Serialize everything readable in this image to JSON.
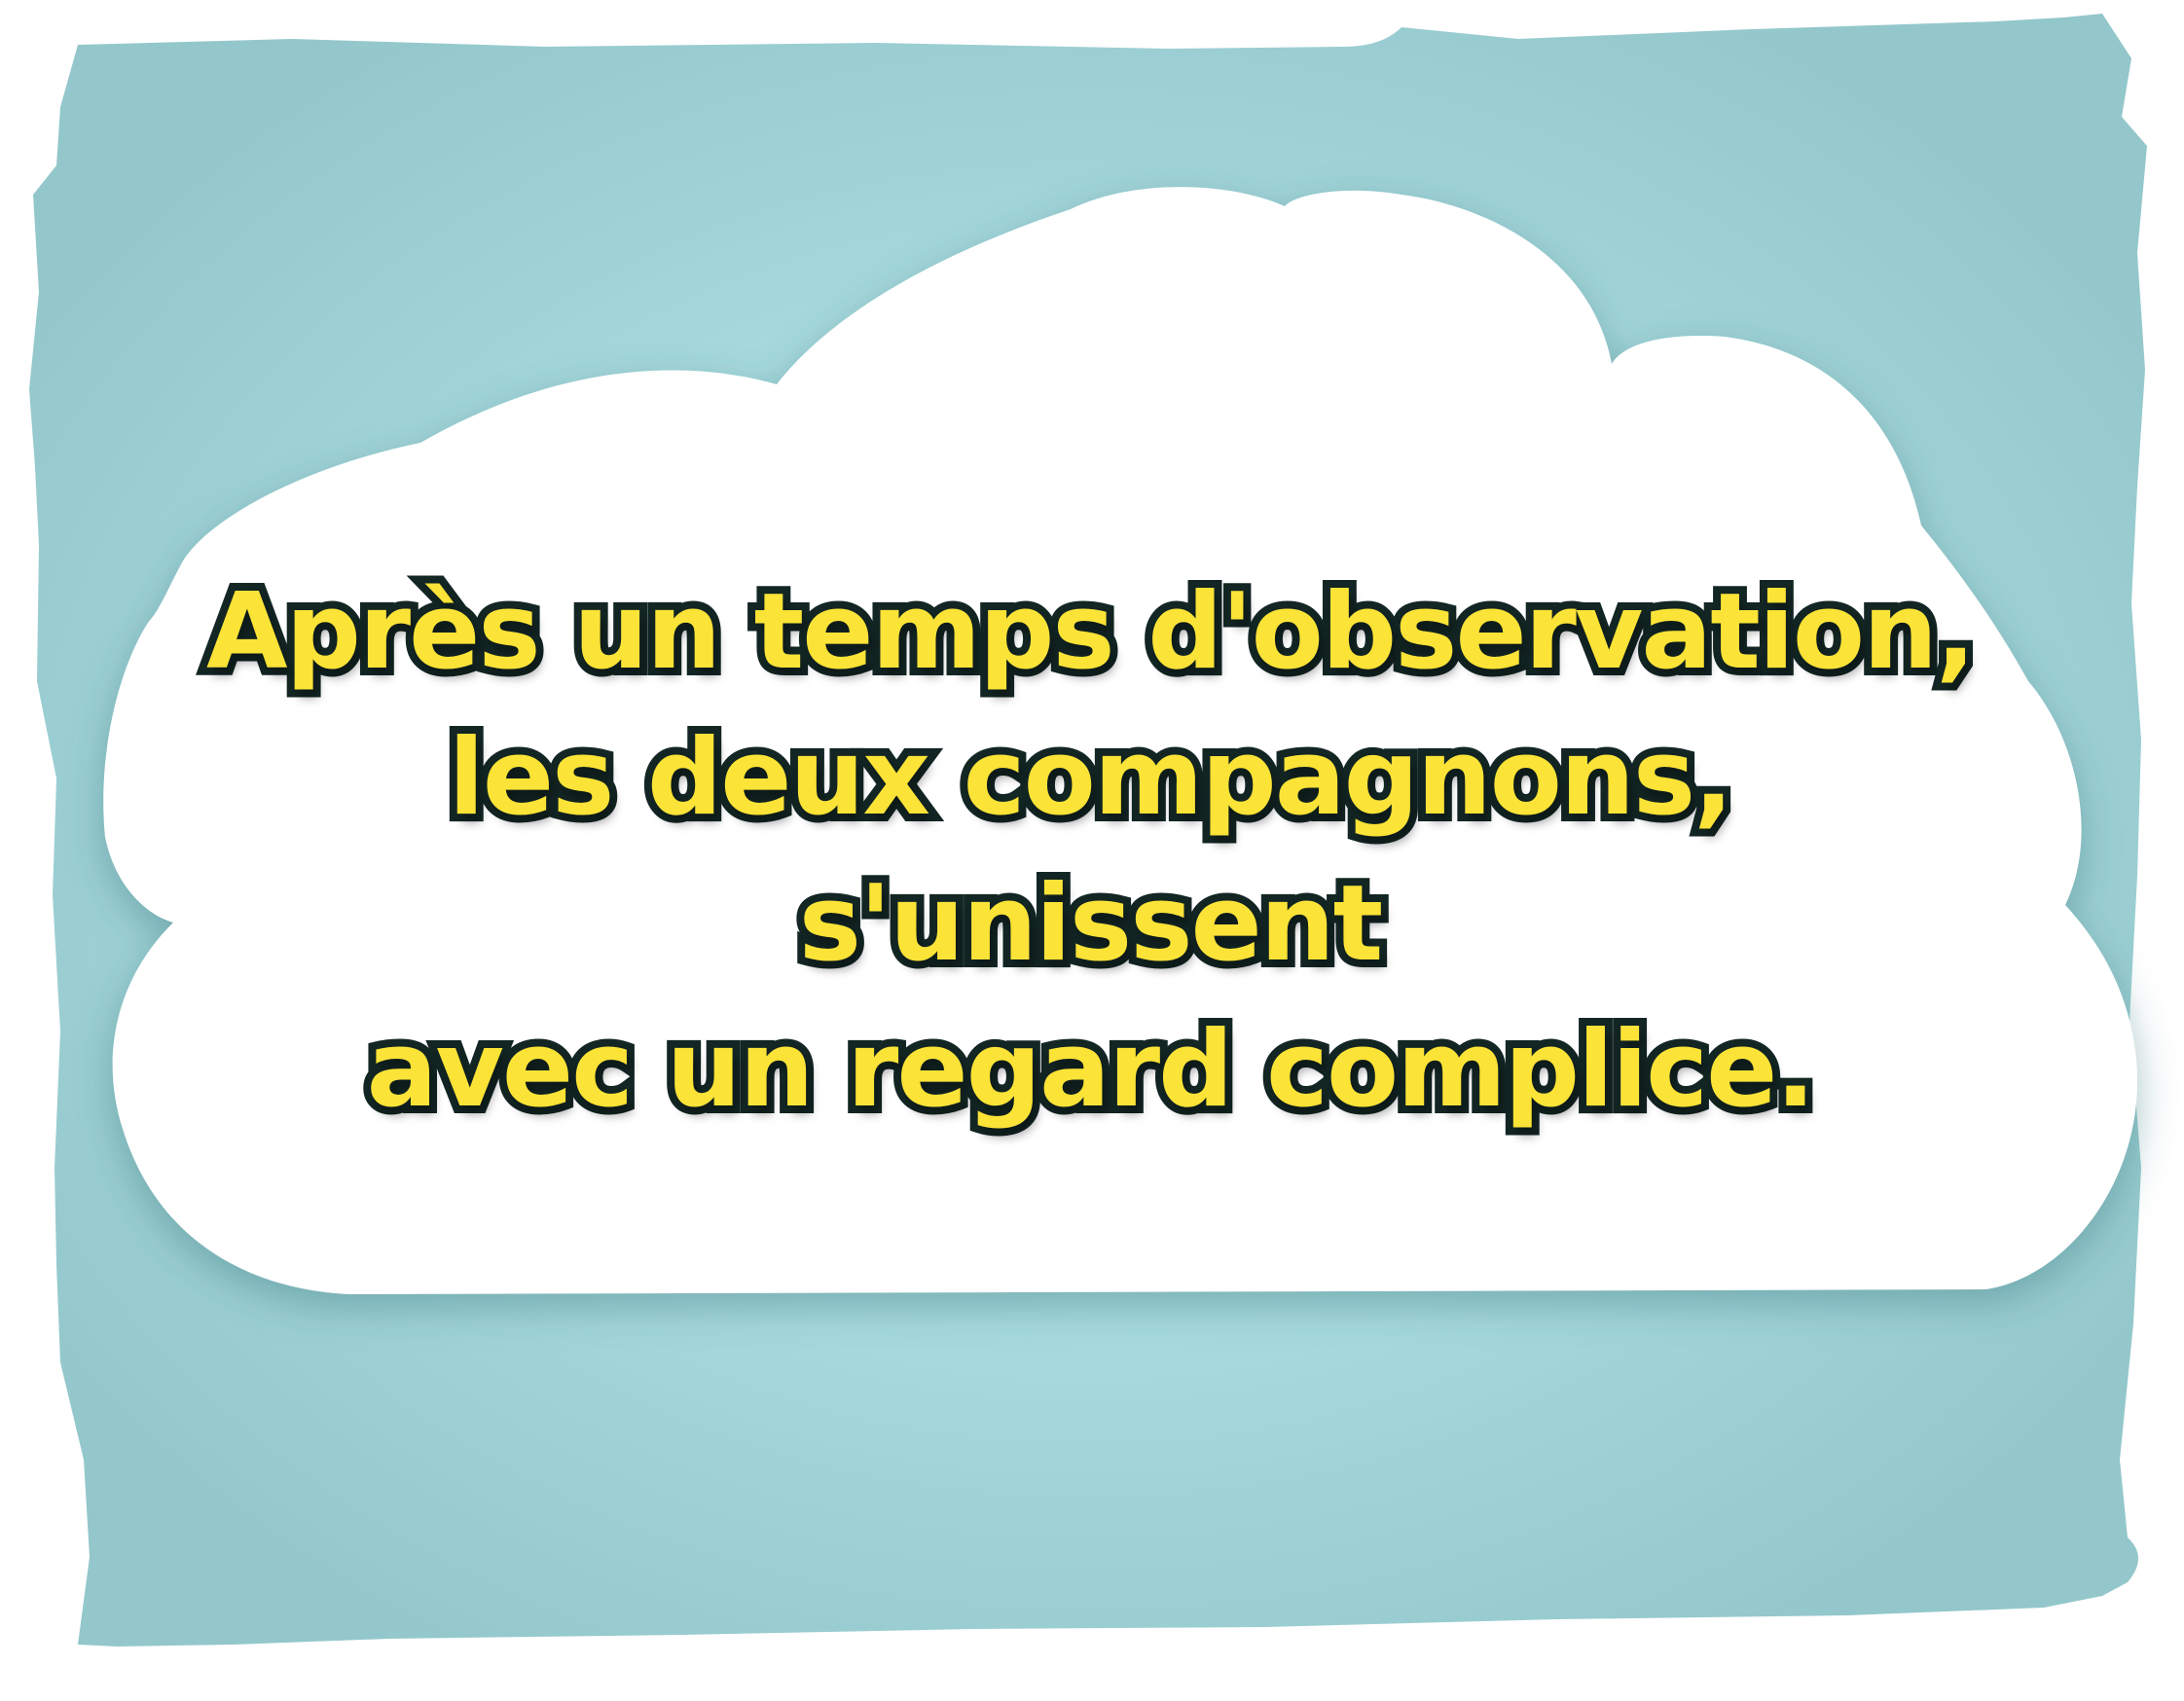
{
  "caption": {
    "lines": [
      "Après un temps d'observation,",
      "les deux compagnons,",
      "s'unissent",
      "avec un regard complice."
    ]
  },
  "colors": {
    "sky": "#9fd3d8",
    "sky_light": "#b0e2e6",
    "cloud": "#ffffff",
    "text_fill": "#fbe337",
    "text_outline": "#132624"
  }
}
